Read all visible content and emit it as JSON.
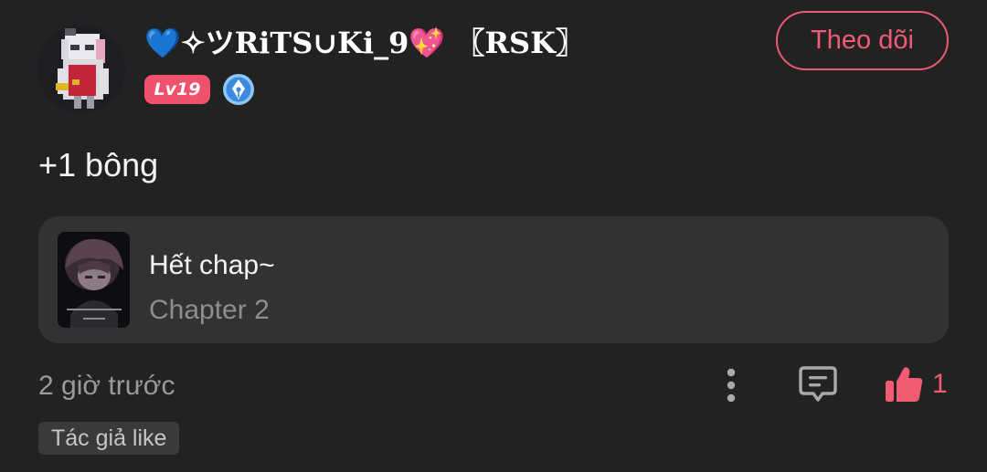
{
  "comment": {
    "username": "💙✧ツRiTS∪Ki_9💖 〖RSK〗",
    "level": "Lv19",
    "follow_label": "Theo dõi",
    "text": "+1 bông",
    "chapter": {
      "title": "Hết chap~",
      "subtitle": "Chapter 2"
    },
    "time": "2 giờ trước",
    "like_count": "1",
    "author_tag": "Tác giả like"
  },
  "icons": {
    "more": "more-vertical-icon",
    "reply": "comment-reply-icon",
    "like": "thumbs-up-icon",
    "creator": "pen-nib-badge-icon"
  },
  "colors": {
    "background": "#222223",
    "accent": "#f25c73",
    "card": "#323233",
    "muted": "#9a9a9e"
  }
}
